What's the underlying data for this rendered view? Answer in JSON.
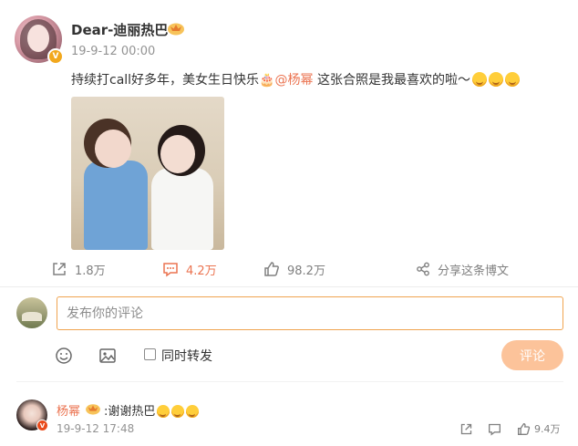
{
  "post": {
    "author": "Dear-迪丽热巴",
    "author_badge": "crown-icon",
    "verified": "V",
    "time": "19-9-12 00:00",
    "text_before": "持续打call好多年，美女生日快乐",
    "cake_emoji": "🎂",
    "mention": "@杨幂",
    "text_after": " 这张合照是我最喜欢的啦～",
    "emoji_count": 3,
    "image": "photo of two women"
  },
  "actions": {
    "repost": "1.8万",
    "comment": "4.2万",
    "like": "98.2万",
    "share": "分享这条博文",
    "active_color": "#eb7350"
  },
  "composer": {
    "placeholder": "发布你的评论",
    "repost_label": "同时转发",
    "submit": "评论",
    "submit_color": "#fcc39a"
  },
  "reply": {
    "author": "杨幂",
    "verified": "V",
    "text": ":谢谢热巴",
    "time": "19-9-12 17:48",
    "like_count": "9.4万"
  }
}
